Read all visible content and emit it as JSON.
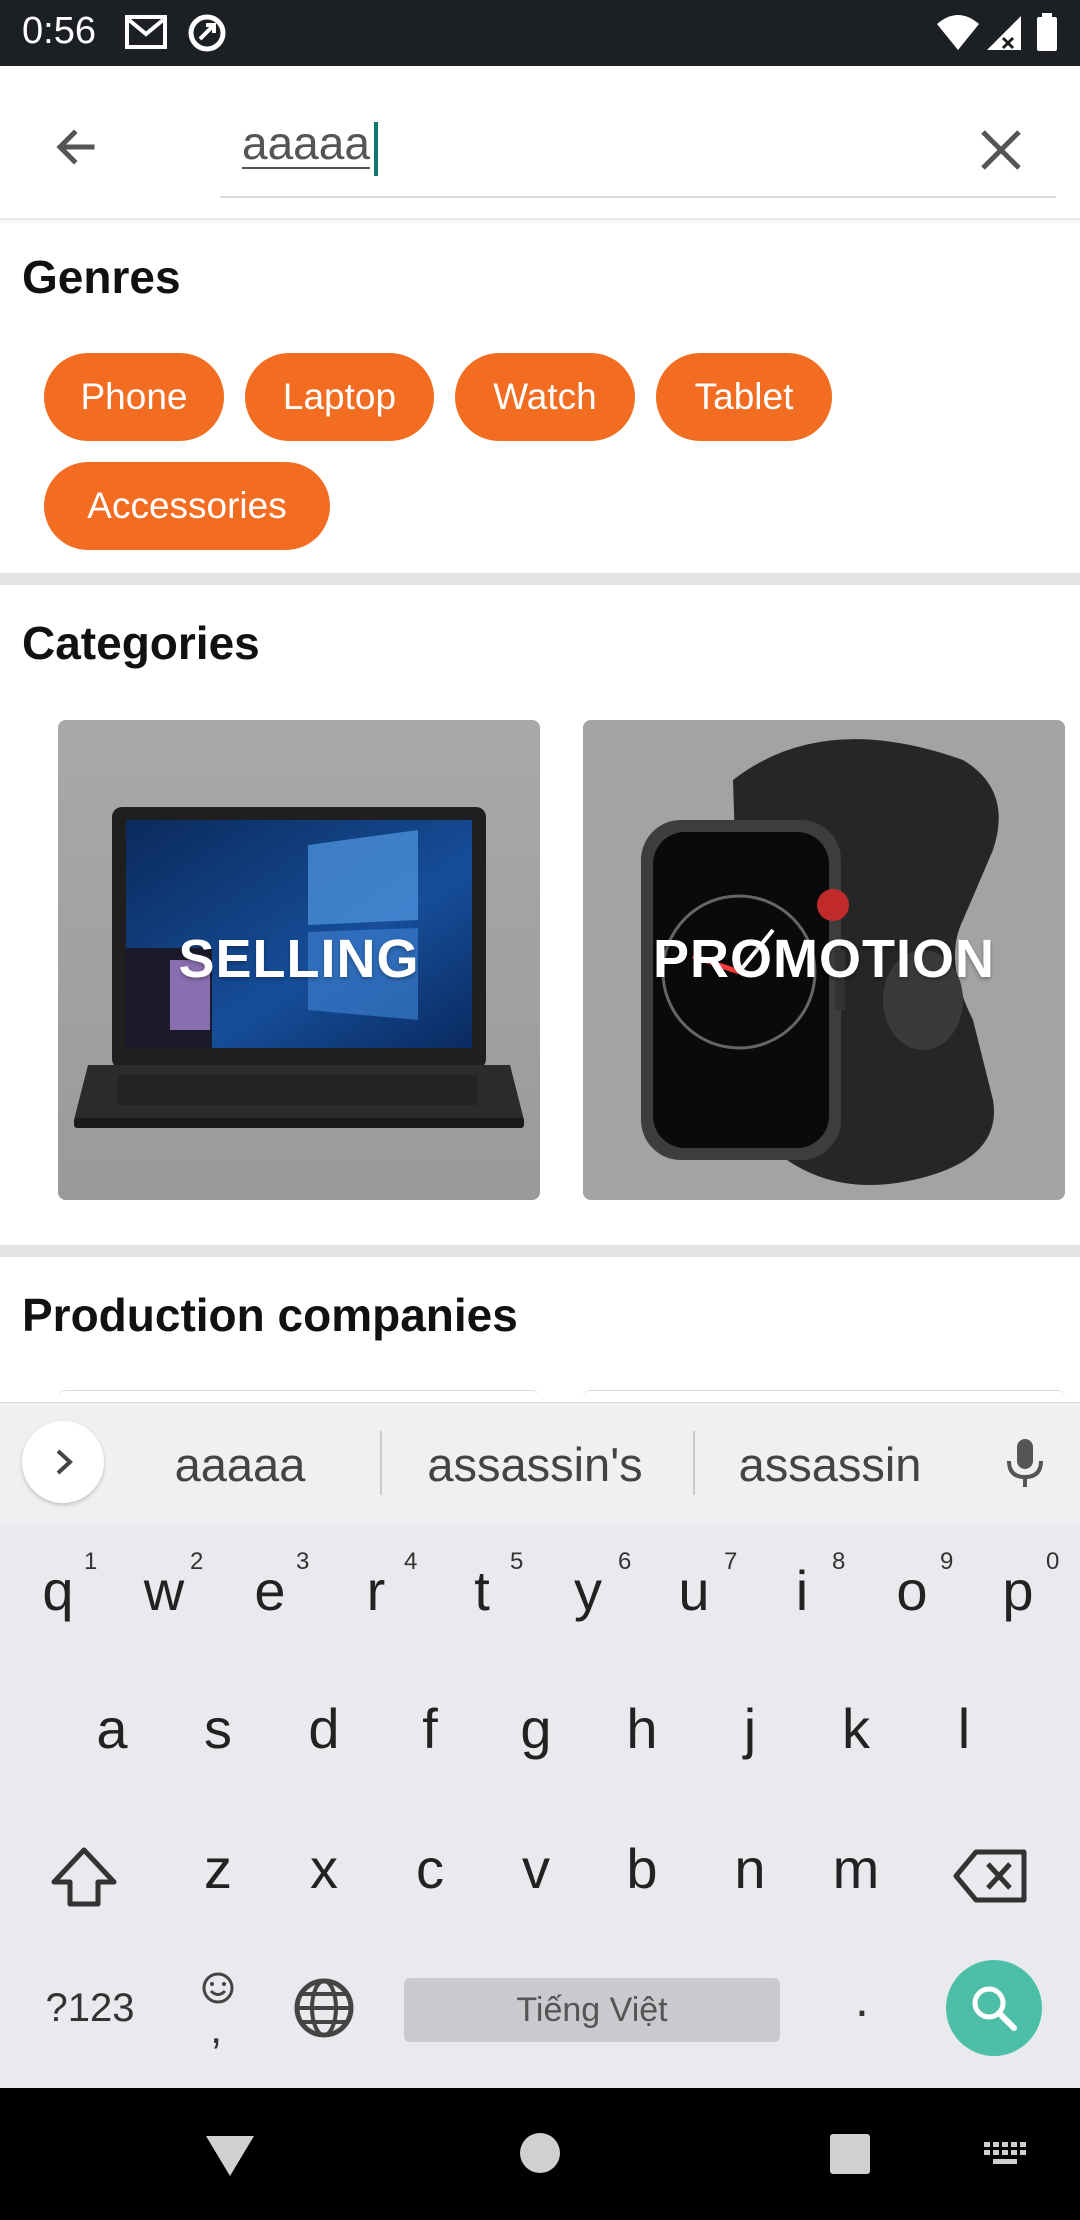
{
  "status_bar": {
    "time": "0:56",
    "icons": [
      "gmail-icon",
      "sync-icon",
      "wifi-icon",
      "signal-icon",
      "battery-icon"
    ]
  },
  "search": {
    "value": "aaaaa",
    "back_icon": "arrow-left-icon",
    "clear_icon": "close-icon"
  },
  "genres": {
    "title": "Genres",
    "chips": [
      "Phone",
      "Laptop",
      "Watch",
      "Tablet",
      "Accessories"
    ]
  },
  "categories": {
    "title": "Categories",
    "cards": [
      {
        "label": "SELLING"
      },
      {
        "label": "PROMOTION"
      }
    ]
  },
  "production": {
    "title": "Production companies"
  },
  "keyboard": {
    "suggestions": [
      "aaaaa",
      "assassin's",
      "assassin"
    ],
    "row1": [
      "q",
      "w",
      "e",
      "r",
      "t",
      "y",
      "u",
      "i",
      "o",
      "p"
    ],
    "row1_hints": [
      "1",
      "2",
      "3",
      "4",
      "5",
      "6",
      "7",
      "8",
      "9",
      "0"
    ],
    "row2": [
      "a",
      "s",
      "d",
      "f",
      "g",
      "h",
      "j",
      "k",
      "l"
    ],
    "row3": [
      "z",
      "x",
      "c",
      "v",
      "b",
      "n",
      "m"
    ],
    "symbols_label": "?123",
    "emoji_comma": ",",
    "space_label": "Tiếng Việt",
    "period": "."
  },
  "colors": {
    "accent": "#f26d21",
    "search_key": "#4dbfa8",
    "status_bar": "#1c1f24"
  }
}
